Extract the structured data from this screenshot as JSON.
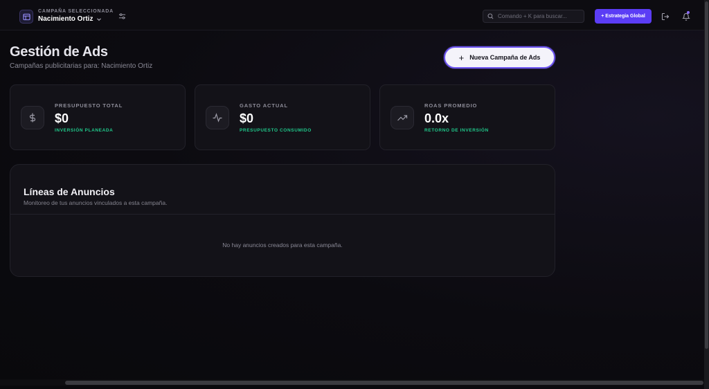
{
  "topbar": {
    "campaign_caption": "CAMPAÑA SELECCIONADA",
    "campaign_name": "Nacimiento Ortiz",
    "search_placeholder": "Comando + K para buscar...",
    "global_strategy_label": "+ Estrategia Global"
  },
  "header": {
    "title": "Gestión de Ads",
    "subtitle": "Campañas publicitarias para: Nacimiento Ortiz",
    "new_campaign_label": "Nueva Campaña de Ads"
  },
  "stats": [
    {
      "icon": "dollar-icon",
      "label": "PRESUPUESTO TOTAL",
      "value": "$0",
      "note": "INVERSIÓN PLANEADA"
    },
    {
      "icon": "activity-icon",
      "label": "GASTO ACTUAL",
      "value": "$0",
      "note": "PRESUPUESTO CONSUMIDO"
    },
    {
      "icon": "trending-up-icon",
      "label": "ROAS PROMEDIO",
      "value": "0.0x",
      "note": "RETORNO DE INVERSIÓN"
    }
  ],
  "ads_panel": {
    "title": "Líneas de Anuncios",
    "subtitle": "Monitoreo de tus anuncios vinculados a esta campaña.",
    "empty_message": "No hay anuncios creados para esta campaña."
  },
  "colors": {
    "accent": "#5b3df5",
    "positive": "#20c98b",
    "background": "#0b0a0f"
  }
}
